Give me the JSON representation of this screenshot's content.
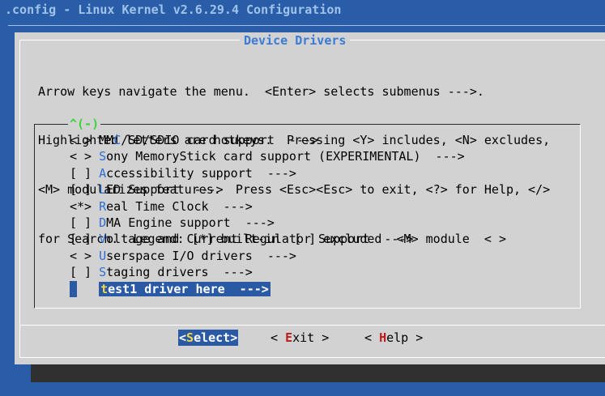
{
  "window": {
    "title": ".config - Linux Kernel v2.6.29.4 Configuration"
  },
  "dialog": {
    "title": "Device Drivers",
    "help_lines": [
      "Arrow keys navigate the menu.  <Enter> selects submenus --->.",
      "Highlighted letters are hotkeys.  Pressing <Y> includes, <N> excludes,",
      "<M> modularizes features.  Press <Esc><Esc> to exit, <?> for Help, </>",
      "for Search.  Legend: [*] built-in  [ ] excluded  <M> module  < >"
    ],
    "scroll_indicator": "^(-)"
  },
  "menu": {
    "items": [
      {
        "prefix": "< > ",
        "lead": "MM",
        "hot": "C",
        "rest": "/SD/SDIO card support  --->"
      },
      {
        "prefix": "< > ",
        "lead": "",
        "hot": "S",
        "rest": "ony MemoryStick card support (EXPERIMENTAL)  --->"
      },
      {
        "prefix": "[ ] ",
        "lead": "",
        "hot": "A",
        "rest": "ccessibility support  --->"
      },
      {
        "prefix": "[ ] ",
        "lead": "",
        "hot": "L",
        "rest": "ED Support  --->"
      },
      {
        "prefix": "<*> ",
        "lead": "",
        "hot": "R",
        "rest": "eal Time Clock  --->"
      },
      {
        "prefix": "[ ] ",
        "lead": "",
        "hot": "D",
        "rest": "MA Engine support  --->"
      },
      {
        "prefix": "[ ] ",
        "lead": "",
        "hot": "V",
        "rest": "oltage and Current Regulator Support  --->"
      },
      {
        "prefix": "< > ",
        "lead": "",
        "hot": "U",
        "rest": "serspace I/O drivers  --->"
      },
      {
        "prefix": "[ ] ",
        "lead": "",
        "hot": "S",
        "rest": "taging drivers  --->"
      }
    ],
    "selected": {
      "hot": "t",
      "rest": "est1 driver here  --->"
    }
  },
  "buttons": {
    "select": {
      "open": "<",
      "hot": "S",
      "rest": "elect>"
    },
    "exit": {
      "open": "< ",
      "hot": "E",
      "rest": "xit >"
    },
    "help": {
      "open": "< ",
      "hot": "H",
      "rest": "elp >"
    }
  },
  "colors": {
    "background": "#2a5da8",
    "dialog": "#d2d2d2",
    "selection": "#2b5aa5",
    "hotkey": "#2e6fd6",
    "button_hotkey": "#c01a1a",
    "title": "#3a7bd5"
  }
}
